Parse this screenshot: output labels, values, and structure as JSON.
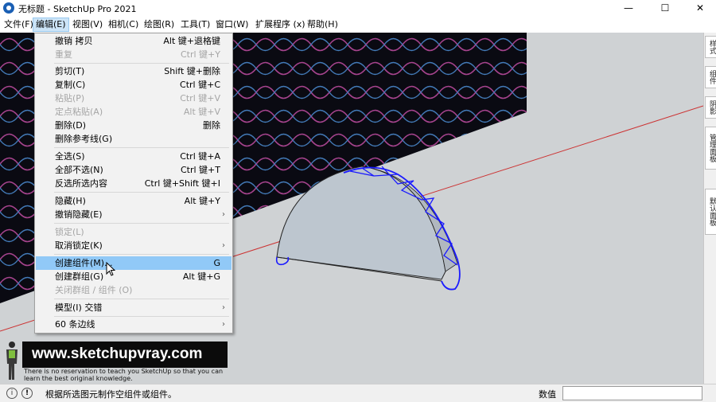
{
  "window": {
    "title": "无标题 - SketchUp Pro 2021",
    "min_symbol": "—",
    "max_symbol": "☐",
    "close_symbol": "✕",
    "app_icon": "sketchup-logo-icon"
  },
  "menubar": {
    "items": [
      {
        "label": "文件(F)"
      },
      {
        "label": "编辑(E)",
        "active": true
      },
      {
        "label": "视图(V)"
      },
      {
        "label": "相机(C)"
      },
      {
        "label": "绘图(R)"
      },
      {
        "label": "工具(T)"
      },
      {
        "label": "窗口(W)"
      },
      {
        "label": "扩展程序 (x)"
      },
      {
        "label": "帮助(H)"
      }
    ]
  },
  "edit_menu": {
    "items": [
      {
        "label": "撤销 拷贝",
        "shortcut": "Alt 键+退格键",
        "disabled": false
      },
      {
        "label": "重复",
        "shortcut": "Ctrl 键+Y",
        "disabled": true
      },
      {
        "label": "剪切(T)",
        "shortcut": "Shift 键+删除",
        "disabled": false
      },
      {
        "label": "复制(C)",
        "shortcut": "Ctrl 键+C",
        "disabled": false
      },
      {
        "label": "粘贴(P)",
        "shortcut": "Ctrl 键+V",
        "disabled": true
      },
      {
        "label": "定点粘贴(A)",
        "shortcut": "Alt 键+V",
        "disabled": true
      },
      {
        "label": "删除(D)",
        "shortcut": "删除",
        "disabled": false
      },
      {
        "label": "删除参考线(G)",
        "shortcut": "",
        "disabled": false
      },
      {
        "label": "全选(S)",
        "shortcut": "Ctrl 键+A",
        "disabled": false
      },
      {
        "label": "全部不选(N)",
        "shortcut": "Ctrl 键+T",
        "disabled": false
      },
      {
        "label": "反选所选内容",
        "shortcut": "Ctrl 键+Shift 键+I",
        "disabled": false
      },
      {
        "label": "隐藏(H)",
        "shortcut": "Alt 键+Y",
        "disabled": false
      },
      {
        "label": "撤销隐藏(E)",
        "shortcut": "",
        "submenu": true,
        "disabled": false
      },
      {
        "label": "锁定(L)",
        "shortcut": "",
        "disabled": true
      },
      {
        "label": "取消锁定(K)",
        "shortcut": "",
        "submenu": true,
        "disabled": false
      },
      {
        "label": "创建组件(M)...",
        "shortcut": "G",
        "disabled": false,
        "highlighted": true
      },
      {
        "label": "创建群组(G)",
        "shortcut": "Alt 键+G",
        "disabled": false
      },
      {
        "label": "关闭群组 / 组件 (O)",
        "shortcut": "",
        "disabled": true
      },
      {
        "label": "模型(I) 交错",
        "shortcut": "",
        "submenu": true,
        "disabled": false
      },
      {
        "label": "60 条边线",
        "shortcut": "",
        "submenu": true,
        "disabled": false
      }
    ],
    "submenu_arrow": "›"
  },
  "tray": {
    "tabs": [
      "样式",
      "组件",
      "阴影",
      "管理面板",
      "默认面板"
    ]
  },
  "watermark": {
    "url": "www.sketchupvray.com",
    "tagline": "There is no reservation to teach you SketchUp so that you can learn the best original knowledge."
  },
  "statusbar": {
    "icon1": "info-icon",
    "icon2": "help-icon",
    "icon1_glyph": "i",
    "icon2_glyph": "!",
    "message": "根据所选图元制作空组件或组件。",
    "value_label": "数值",
    "value_input": ""
  },
  "colors": {
    "selection_edge": "#1a1aff",
    "menu_highlight": "#91c9f7",
    "axis_red": "#cc3333",
    "face_fill": "#bdc6cf"
  }
}
